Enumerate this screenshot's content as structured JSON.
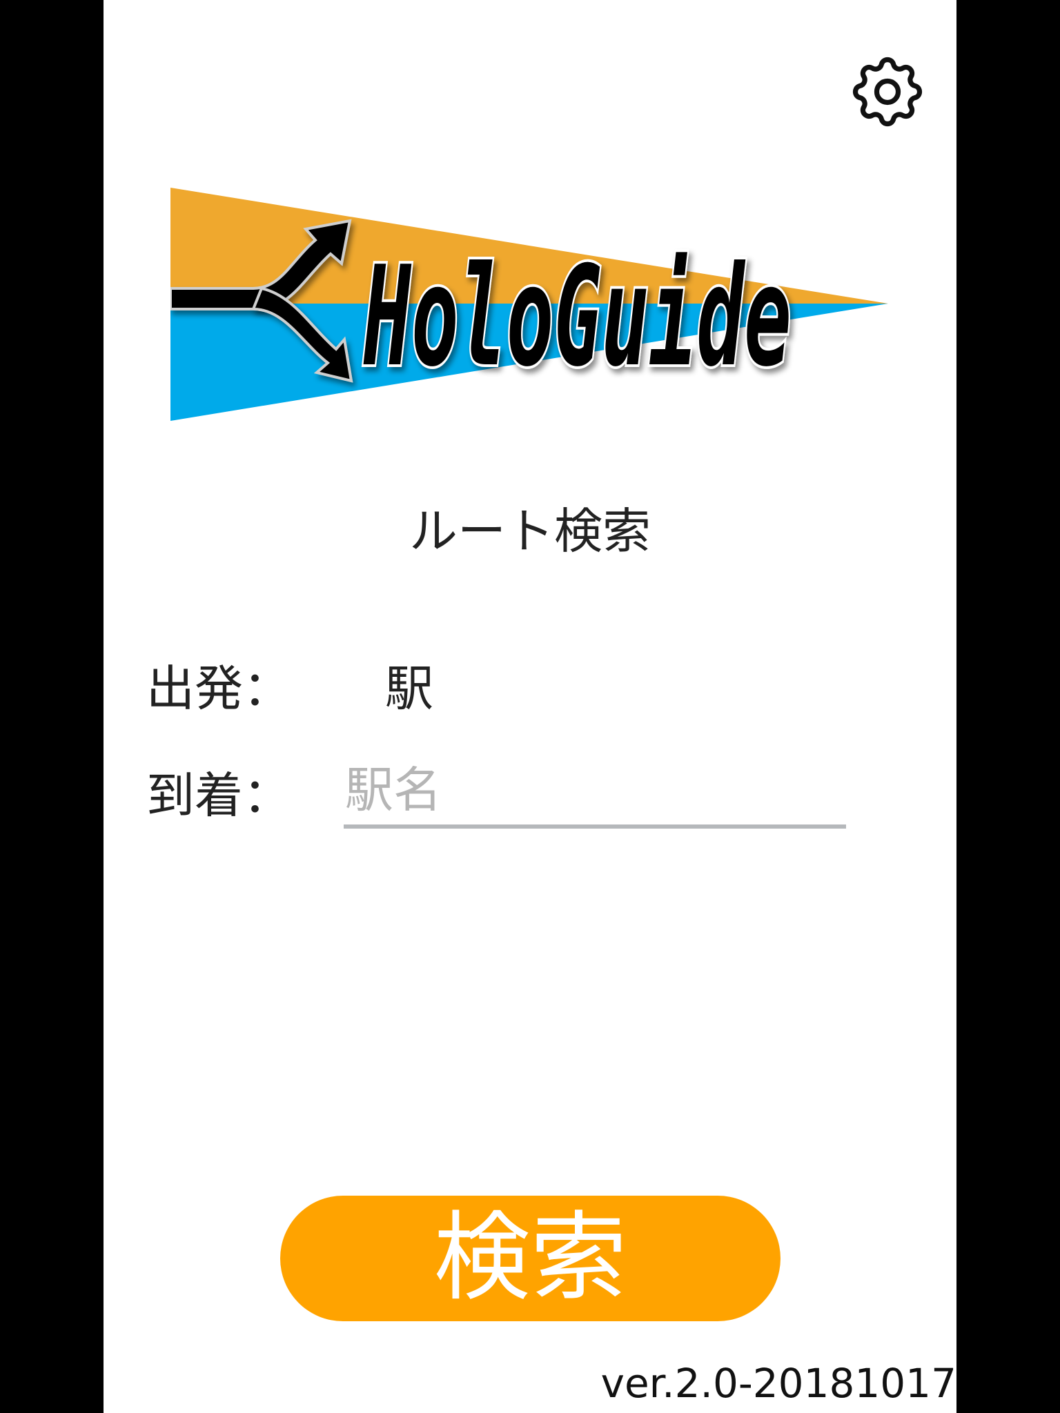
{
  "header": {
    "settings_icon": "gear-icon"
  },
  "logo": {
    "text": "HoloGuide",
    "colors": {
      "orange": "#EFA82E",
      "blue": "#00AAEA",
      "ink": "#000000"
    },
    "icon": "route-fork-arrow-icon"
  },
  "route_search": {
    "title": "ルート検索",
    "departure_label": "出発：",
    "departure_value": "駅",
    "arrival_label": "到着：",
    "arrival_value": "",
    "arrival_placeholder": "駅名",
    "search_button": "検索"
  },
  "footer": {
    "version": "ver.2.0-20181017"
  },
  "colors": {
    "accent": "#FFA300",
    "input_underline": "#B5B8BB",
    "placeholder": "#B5B5B5",
    "text": "#222222"
  }
}
